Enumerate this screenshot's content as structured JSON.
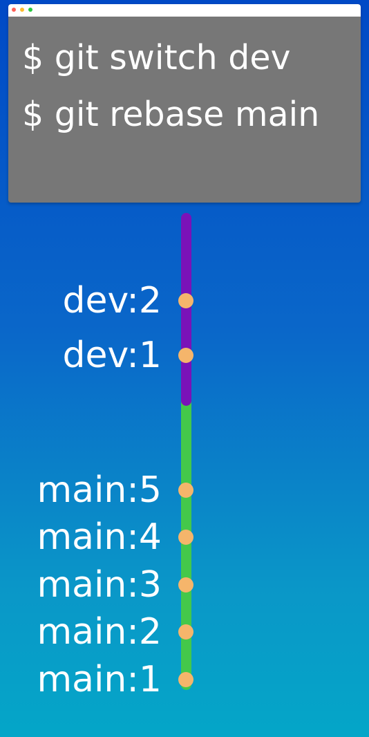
{
  "terminal": {
    "commands": [
      "$ git switch dev",
      "$ git rebase main"
    ],
    "window_dots": [
      "#ff5f57",
      "#febc2e",
      "#28c840"
    ]
  },
  "colors": {
    "background_top": "#0049c6",
    "background_bottom": "#04a6c8",
    "dev_branch": "#7a12b8",
    "main_branch": "#44c84a",
    "commit_dot": "#f5b56b"
  },
  "branches": [
    {
      "name": "dev",
      "commits": [
        {
          "label": "dev:2"
        },
        {
          "label": "dev:1"
        }
      ]
    },
    {
      "name": "main",
      "commits": [
        {
          "label": "main:5"
        },
        {
          "label": "main:4"
        },
        {
          "label": "main:3"
        },
        {
          "label": "main:2"
        },
        {
          "label": "main:1"
        }
      ]
    }
  ]
}
